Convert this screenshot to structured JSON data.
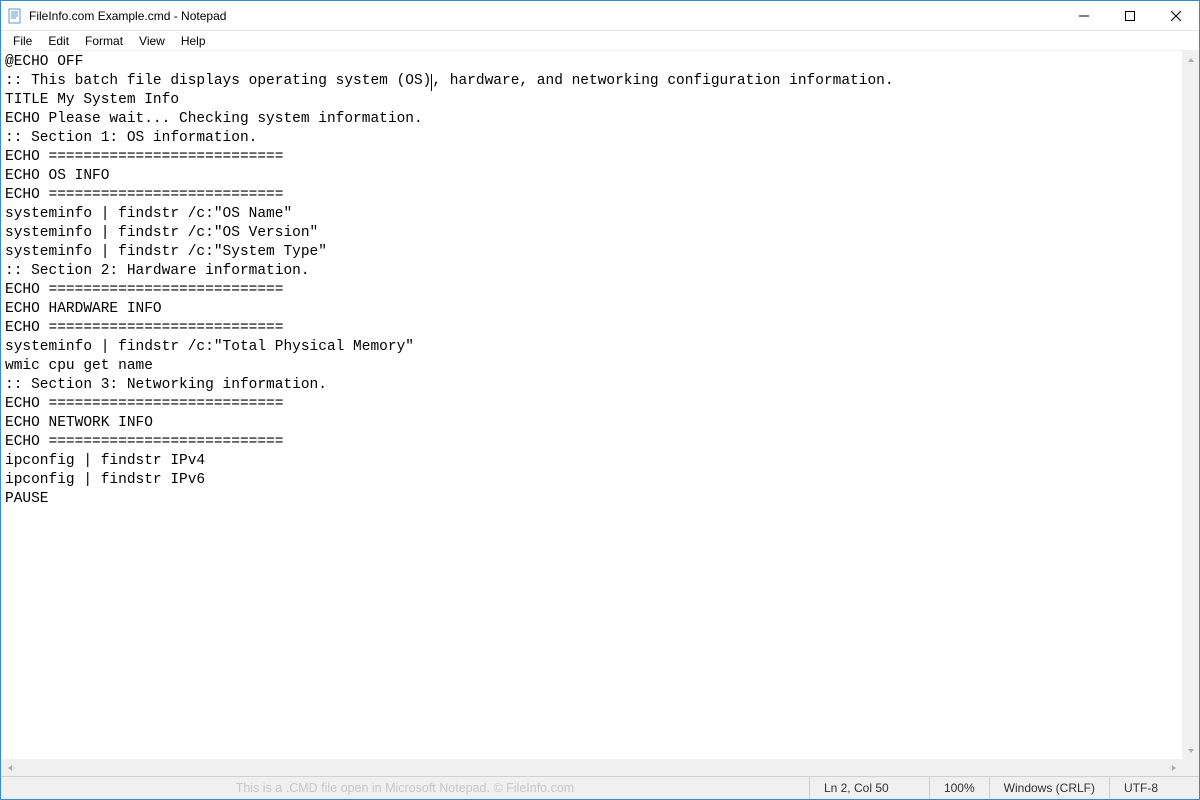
{
  "window": {
    "title": "FileInfo.com Example.cmd - Notepad"
  },
  "menu": {
    "file": "File",
    "edit": "Edit",
    "format": "Format",
    "view": "View",
    "help": "Help"
  },
  "editor": {
    "before_caret_line1": "@ECHO OFF",
    "caret_prefix": ":: This batch file displays operating system (OS)",
    "caret_suffix": ", hardware, and networking configuration information.",
    "rest": "TITLE My System Info\nECHO Please wait... Checking system information.\n:: Section 1: OS information.\nECHO ===========================\nECHO OS INFO\nECHO ===========================\nsysteminfo | findstr /c:\"OS Name\"\nsysteminfo | findstr /c:\"OS Version\"\nsysteminfo | findstr /c:\"System Type\"\n:: Section 2: Hardware information.\nECHO ===========================\nECHO HARDWARE INFO\nECHO ===========================\nsysteminfo | findstr /c:\"Total Physical Memory\"\nwmic cpu get name\n:: Section 3: Networking information.\nECHO ===========================\nECHO NETWORK INFO\nECHO ===========================\nipconfig | findstr IPv4\nipconfig | findstr IPv6\nPAUSE"
  },
  "status": {
    "message": "This is a .CMD file open in Microsoft Notepad. © FileInfo.com",
    "position": "Ln 2, Col 50",
    "zoom": "100%",
    "eol": "Windows (CRLF)",
    "encoding": "UTF-8"
  }
}
